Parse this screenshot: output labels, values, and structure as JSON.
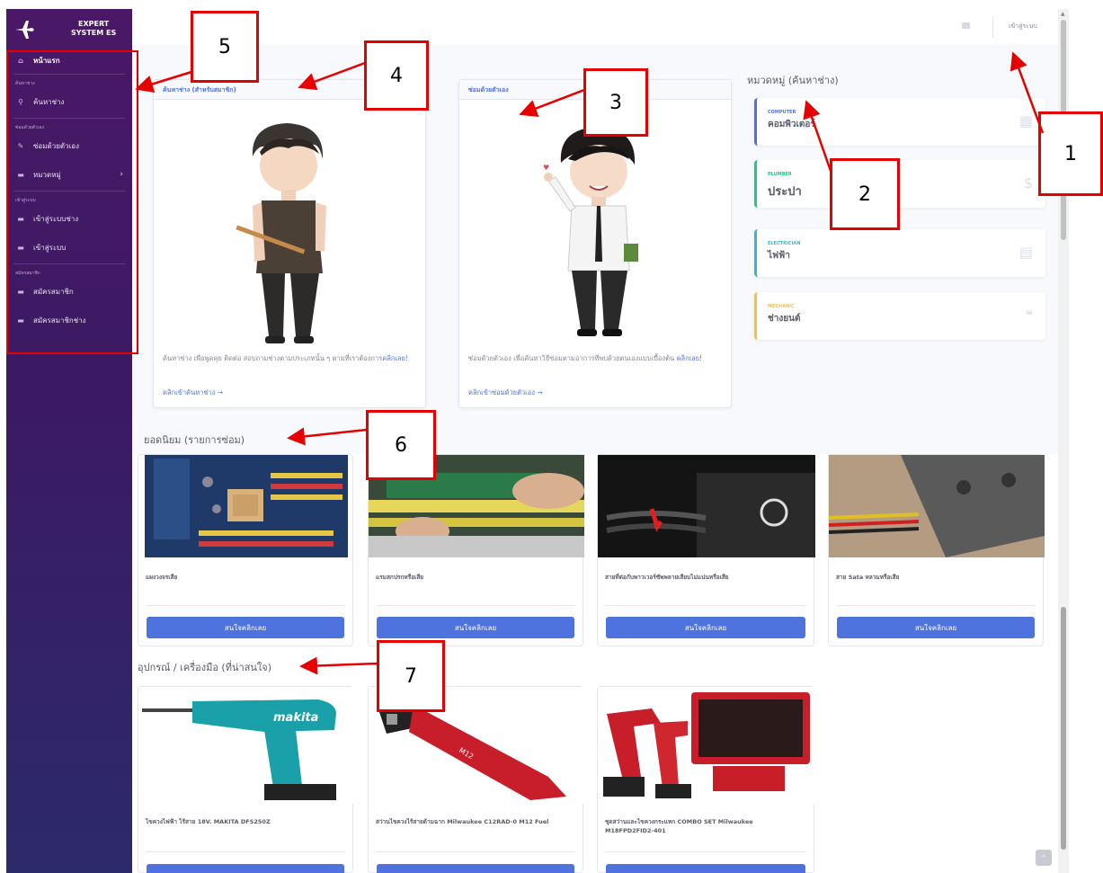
{
  "sidebar": {
    "brand_line1": "EXPERT",
    "brand_line2": "SYSTEM ES",
    "home": "หน้าแรก",
    "section_search": "ค้นหาช่าง",
    "search_item": "ค้นหาช่าง",
    "section_repair": "ซ่อมด้วยตัวเอง",
    "repair_item": "ซ่อมด้วยตัวเอง",
    "category_item": "หมวดหมู่",
    "section_login": "เข้าสู่ระบบ",
    "login_tech": "เข้าสู่ระบบช่าง",
    "login_user": "เข้าสู่ระบบ",
    "section_register": "สมัครสมาชิก",
    "register_member": "สมัครสมาชิก",
    "register_tech": "สมัครสมาชิกช่าง"
  },
  "topbar": {
    "login_label": "เข้าสู่ระบบ",
    "mail_icon": "envelope-icon"
  },
  "find_tech_card": {
    "header": "ค้นหาช่าง (สำหรับสมาชิก)",
    "text": "ค้นหาช่าง เพื่อพูดคุย ติดต่อ สอบถามช่างตามประเภทนั้น ๆ ตามที่เราต้องการ",
    "text_link": "คลิกเลย!",
    "footer_link": "คลิกเข้าค้นหาช่าง →"
  },
  "self_repair_card": {
    "header": "ซ่อมด้วยตัวเอง",
    "text": "ซ่อมด้วยตัวเอง เพื่อค้นหาวิธีซ่อมตามอาการที่พบด้วยตนเองแบบเบื้องต้น",
    "text_link": "คลิกเลย!",
    "footer_link": "คลิกเข้าซ่อมด้วยตัวเอง →"
  },
  "categories": {
    "title": "หมวดหมู่ (ค้นหาช่าง)",
    "items": [
      {
        "en": "COMPUTER",
        "th": "คอมพิวเตอร์",
        "color": "#4e73df",
        "icon": "calendar-icon"
      },
      {
        "en": "PLUMBER",
        "th": "ประปา",
        "color": "#1cc88a",
        "icon": "dollar-icon"
      },
      {
        "en": "ELECTRICIAN",
        "th": "ไฟฟ้า",
        "color": "#36b9cc",
        "icon": "clipboard-icon"
      },
      {
        "en": "MECHANIC",
        "th": "ช่างยนต์",
        "color": "#f6c23e",
        "icon": "comments-icon"
      }
    ]
  },
  "popular": {
    "title": "ยอดนิยม (รายการซ่อม)",
    "button_label": "สนใจคลิกเลย",
    "items": [
      {
        "name": "แผงวงจรเสีย"
      },
      {
        "name": "แรมสกปรกหรือเสีย"
      },
      {
        "name": "สายที่ต่อกับพาวเวอร์ซัพพลายเสียบไม่แน่นหรือเสีย"
      },
      {
        "name": "สาย Sata หลวมหรือเสีย"
      }
    ]
  },
  "tools": {
    "title": "อุปกรณ์ / เครื่องมือ (ที่น่าสนใจ)",
    "items": [
      {
        "name": "ไขควงไฟฟ้า ไร้สาย 18V. MAKITA DFS250Z"
      },
      {
        "name": "สว่านไขควงไร้สายด้ามฉาก Milwaukee C12RAD-0 M12 Fuel"
      },
      {
        "name": "ชุดสว่านและไขควงกระแทก COMBO SET Milwaukee M18FPD2FID2-401"
      }
    ]
  },
  "annotations": [
    "1",
    "2",
    "3",
    "4",
    "5",
    "6",
    "7"
  ],
  "brand_color": "#4e73df"
}
